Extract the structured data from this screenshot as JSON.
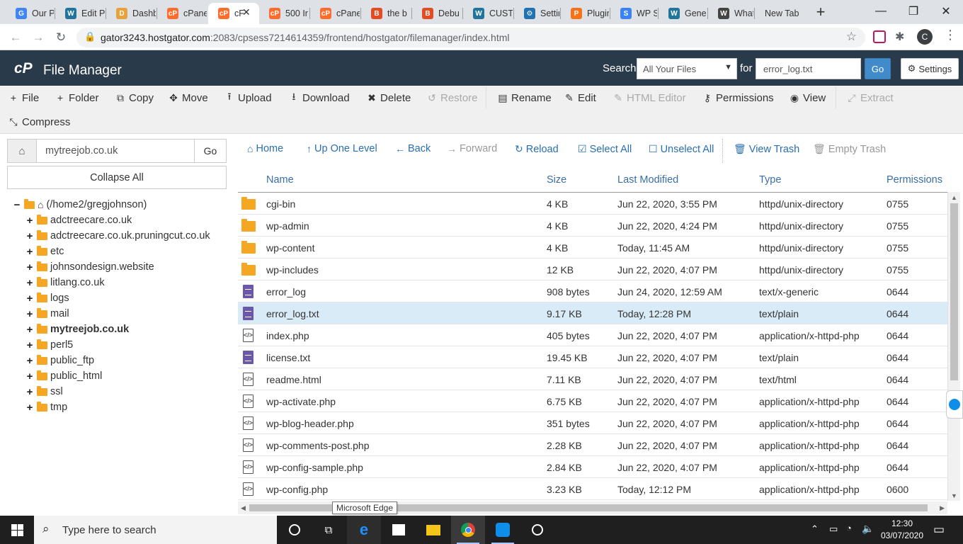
{
  "browser": {
    "tabs": [
      {
        "title": "Our P",
        "favicon": "google-icon",
        "color": "#4285f4",
        "glyph": "G"
      },
      {
        "title": "Edit P",
        "favicon": "wordpress-icon",
        "color": "#21759b",
        "glyph": "W"
      },
      {
        "title": "Dashb",
        "favicon": "dashboard-icon",
        "color": "#e9a13b",
        "glyph": "D"
      },
      {
        "title": "cPane",
        "favicon": "cpanel-icon",
        "color": "#ff6c2c",
        "glyph": "cP"
      },
      {
        "title": "cF",
        "favicon": "cpanel-icon",
        "color": "#ff6c2c",
        "glyph": "cP",
        "active": true
      },
      {
        "title": "500 Ir",
        "favicon": "cpanel-icon",
        "color": "#ff6c2c",
        "glyph": "cP"
      },
      {
        "title": "cPane",
        "favicon": "cpanel-icon",
        "color": "#ff6c2c",
        "glyph": "cP"
      },
      {
        "title": "the b",
        "favicon": "bookmark-icon",
        "color": "#e44b23",
        "glyph": "B"
      },
      {
        "title": "Debu",
        "favicon": "bookmark-icon",
        "color": "#e44b23",
        "glyph": "B"
      },
      {
        "title": "CUST",
        "favicon": "wordpress-icon",
        "color": "#21759b",
        "glyph": "W"
      },
      {
        "title": "Settin",
        "favicon": "gear-icon",
        "color": "#2271b1",
        "glyph": "⚙"
      },
      {
        "title": "Plugin",
        "favicon": "plugin-icon",
        "color": "#f97316",
        "glyph": "P"
      },
      {
        "title": "WP S",
        "favicon": "wp-security-icon",
        "color": "#3b82f6",
        "glyph": "S"
      },
      {
        "title": "Gener",
        "favicon": "wordpress-icon",
        "color": "#21759b",
        "glyph": "W"
      },
      {
        "title": "What",
        "favicon": "what-icon",
        "color": "#444444",
        "glyph": "W"
      },
      {
        "title": "New Tab",
        "favicon": "",
        "color": "",
        "glyph": ""
      }
    ],
    "url_host": "gator3243.hostgator.com",
    "url_rest": ":2083/cpsess7214614359/frontend/hostgator/filemanager/index.html",
    "profile_initial": "C"
  },
  "header": {
    "title": "File Manager",
    "logo": "cP",
    "search_label": "Search",
    "search_scope": "All Your Files",
    "for_label": "for",
    "search_value": "error_log.txt",
    "go_label": "Go",
    "settings_label": "Settings"
  },
  "toolbar": {
    "items": [
      {
        "label": "File",
        "icon": "plus-icon",
        "glyph": "+",
        "enabled": true
      },
      {
        "label": "Folder",
        "icon": "plus-icon",
        "glyph": "+",
        "enabled": true
      },
      {
        "label": "Copy",
        "icon": "copy-icon",
        "glyph": "⧉",
        "enabled": true
      },
      {
        "label": "Move",
        "icon": "move-icon",
        "glyph": "✥",
        "enabled": true
      },
      {
        "label": "Upload",
        "icon": "upload-icon",
        "glyph": "⭱",
        "enabled": true
      },
      {
        "label": "Download",
        "icon": "download-icon",
        "glyph": "⭳",
        "enabled": true
      },
      {
        "label": "Delete",
        "icon": "delete-icon",
        "glyph": "✖",
        "enabled": true
      },
      {
        "label": "Restore",
        "icon": "restore-icon",
        "glyph": "↺",
        "enabled": false
      },
      {
        "label": "Rename",
        "icon": "file-icon",
        "glyph": "▤",
        "enabled": true
      },
      {
        "label": "Edit",
        "icon": "pencil-icon",
        "glyph": "✎",
        "enabled": true
      },
      {
        "label": "HTML Editor",
        "icon": "html-editor-icon",
        "glyph": "✎",
        "enabled": false
      },
      {
        "label": "Permissions",
        "icon": "key-icon",
        "glyph": "⚷",
        "enabled": true
      },
      {
        "label": "View",
        "icon": "eye-icon",
        "glyph": "◉",
        "enabled": true
      },
      {
        "label": "Extract",
        "icon": "extract-icon",
        "glyph": "⤢",
        "enabled": false
      },
      {
        "label": "Compress",
        "icon": "compress-icon",
        "glyph": "⤡",
        "enabled": true
      }
    ]
  },
  "sidebar": {
    "path_value": "mytreejob.co.uk",
    "go_label": "Go",
    "collapse_label": "Collapse All",
    "root": "(/home2/gregjohnson)",
    "items": [
      {
        "label": "adctreecare.co.uk",
        "bold": false
      },
      {
        "label": "adctreecare.co.uk.pruningcut.co.uk",
        "bold": false
      },
      {
        "label": "etc",
        "bold": false
      },
      {
        "label": "johnsondesign.website",
        "bold": false
      },
      {
        "label": "litlang.co.uk",
        "bold": false
      },
      {
        "label": "logs",
        "bold": false
      },
      {
        "label": "mail",
        "bold": false
      },
      {
        "label": "mytreejob.co.uk",
        "bold": true
      },
      {
        "label": "perl5",
        "bold": false
      },
      {
        "label": "public_ftp",
        "bold": false
      },
      {
        "label": "public_html",
        "bold": false
      },
      {
        "label": "ssl",
        "bold": false
      },
      {
        "label": "tmp",
        "bold": false
      }
    ]
  },
  "nav": {
    "items": [
      {
        "label": "Home",
        "icon": "home-icon",
        "glyph": "⌂",
        "enabled": true
      },
      {
        "label": "Up One Level",
        "icon": "arrow-up-icon",
        "glyph": "↑",
        "enabled": true
      },
      {
        "label": "Back",
        "icon": "arrow-left-icon",
        "glyph": "←",
        "enabled": true
      },
      {
        "label": "Forward",
        "icon": "arrow-right-icon",
        "glyph": "→",
        "enabled": false
      },
      {
        "label": "Reload",
        "icon": "reload-icon",
        "glyph": "↻",
        "enabled": true
      },
      {
        "label": "Select All",
        "icon": "checkbox-checked-icon",
        "glyph": "☑",
        "enabled": true
      },
      {
        "label": "Unselect All",
        "icon": "checkbox-empty-icon",
        "glyph": "☐",
        "enabled": true
      },
      {
        "label": "View Trash",
        "icon": "trash-icon",
        "glyph": "🗑",
        "enabled": true
      },
      {
        "label": "Empty Trash",
        "icon": "trash-icon",
        "glyph": "🗑",
        "enabled": false
      }
    ]
  },
  "table": {
    "columns": [
      "Name",
      "Size",
      "Last Modified",
      "Type",
      "Permissions"
    ],
    "rows": [
      {
        "name": "cgi-bin",
        "size": "4 KB",
        "modified": "Jun 22, 2020, 3:55 PM",
        "type": "httpd/unix-directory",
        "perms": "0755",
        "icon": "folder"
      },
      {
        "name": "wp-admin",
        "size": "4 KB",
        "modified": "Jun 22, 2020, 4:24 PM",
        "type": "httpd/unix-directory",
        "perms": "0755",
        "icon": "folder"
      },
      {
        "name": "wp-content",
        "size": "4 KB",
        "modified": "Today, 11:45 AM",
        "type": "httpd/unix-directory",
        "perms": "0755",
        "icon": "folder"
      },
      {
        "name": "wp-includes",
        "size": "12 KB",
        "modified": "Jun 22, 2020, 4:07 PM",
        "type": "httpd/unix-directory",
        "perms": "0755",
        "icon": "folder"
      },
      {
        "name": "error_log",
        "size": "908 bytes",
        "modified": "Jun 24, 2020, 12:59 AM",
        "type": "text/x-generic",
        "perms": "0644",
        "icon": "textfile"
      },
      {
        "name": "error_log.txt",
        "size": "9.17 KB",
        "modified": "Today, 12:28 PM",
        "type": "text/plain",
        "perms": "0644",
        "icon": "textfile",
        "selected": true
      },
      {
        "name": "index.php",
        "size": "405 bytes",
        "modified": "Jun 22, 2020, 4:07 PM",
        "type": "application/x-httpd-php",
        "perms": "0644",
        "icon": "codefile"
      },
      {
        "name": "license.txt",
        "size": "19.45 KB",
        "modified": "Jun 22, 2020, 4:07 PM",
        "type": "text/plain",
        "perms": "0644",
        "icon": "textfile"
      },
      {
        "name": "readme.html",
        "size": "7.11 KB",
        "modified": "Jun 22, 2020, 4:07 PM",
        "type": "text/html",
        "perms": "0644",
        "icon": "codefile"
      },
      {
        "name": "wp-activate.php",
        "size": "6.75 KB",
        "modified": "Jun 22, 2020, 4:07 PM",
        "type": "application/x-httpd-php",
        "perms": "0644",
        "icon": "codefile"
      },
      {
        "name": "wp-blog-header.php",
        "size": "351 bytes",
        "modified": "Jun 22, 2020, 4:07 PM",
        "type": "application/x-httpd-php",
        "perms": "0644",
        "icon": "codefile"
      },
      {
        "name": "wp-comments-post.php",
        "size": "2.28 KB",
        "modified": "Jun 22, 2020, 4:07 PM",
        "type": "application/x-httpd-php",
        "perms": "0644",
        "icon": "codefile"
      },
      {
        "name": "wp-config-sample.php",
        "size": "2.84 KB",
        "modified": "Jun 22, 2020, 4:07 PM",
        "type": "application/x-httpd-php",
        "perms": "0644",
        "icon": "codefile"
      },
      {
        "name": "wp-config.php",
        "size": "3.23 KB",
        "modified": "Today, 12:12 PM",
        "type": "application/x-httpd-php",
        "perms": "0600",
        "icon": "codefile"
      }
    ]
  },
  "tooltip": "Microsoft Edge",
  "taskbar": {
    "search_placeholder": "Type here to search",
    "time": "12:30",
    "date": "03/07/2020"
  }
}
